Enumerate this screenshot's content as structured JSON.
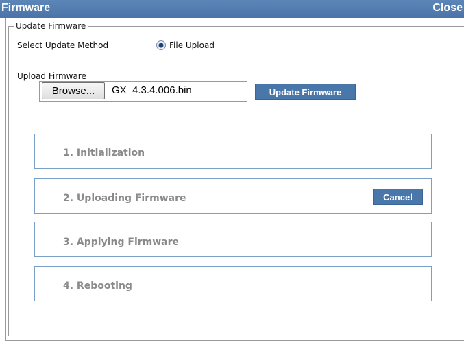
{
  "window": {
    "title": "Firmware",
    "close_label": "Close"
  },
  "update_firmware": {
    "legend": "Update Firmware",
    "method_label": "Select Update Method",
    "method_option": "File Upload",
    "upload_label": "Upload Firmware",
    "browse_label": "Browse...",
    "file_name": "GX_4.3.4.006.bin",
    "update_button": "Update Firmware"
  },
  "steps": [
    {
      "label": "1. Initialization"
    },
    {
      "label": "2. Uploading Firmware",
      "action": "Cancel"
    },
    {
      "label": "3. Applying Firmware"
    },
    {
      "label": "4. Rebooting"
    }
  ],
  "colors": {
    "accent": "#4a77aa",
    "step_text": "#8a8a8a",
    "border": "#7aa0c8"
  }
}
